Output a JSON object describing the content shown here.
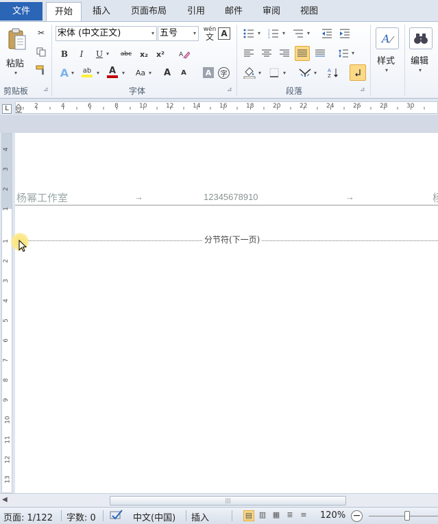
{
  "tabs": {
    "file": "文件",
    "items": [
      "开始",
      "插入",
      "页面布局",
      "引用",
      "邮件",
      "审阅",
      "视图"
    ]
  },
  "ribbon": {
    "clipboard": {
      "paste_label": "粘贴",
      "group_label": "剪贴板"
    },
    "font": {
      "font_name": "宋体 (中文正文)",
      "font_size": "五号",
      "bold": "B",
      "italic": "I",
      "underline": "U",
      "strikethrough": "abc",
      "subscript": "x₂",
      "superscript": "x²",
      "change_case": "Aa",
      "grow_font": "A",
      "shrink_font": "A",
      "phonetic": "wén",
      "char_border": "A",
      "char_shading": "A",
      "enclosed_char": "字",
      "group_label": "字体"
    },
    "paragraph": {
      "group_label": "段落"
    },
    "styles": {
      "label": "样式"
    },
    "editing": {
      "label": "编辑"
    }
  },
  "ruler": {
    "corner": "L",
    "h_numbers": [
      "2",
      "4",
      "6",
      "8",
      "10",
      "12",
      "14",
      "16",
      "18",
      "20",
      "22",
      "24",
      "26",
      "28",
      "30"
    ],
    "v_numbers": [
      "4",
      "3",
      "2",
      "1",
      "1",
      "2",
      "3",
      "4",
      "5",
      "6",
      "7",
      "8",
      "9",
      "10",
      "11",
      "12",
      "13"
    ]
  },
  "document": {
    "header_left": "杨幂工作室",
    "header_tab_arrow": "→",
    "header_center": "12345678910",
    "header_right_partial": "杨",
    "section_break": "分节符(下一页)"
  },
  "status": {
    "page": "页面: 1/122",
    "words": "字数: 0",
    "language": "中文(中国)",
    "mode": "插入",
    "zoom": "120%",
    "zoom_minus": "−"
  },
  "scrollbar": {
    "grip": "|||"
  }
}
